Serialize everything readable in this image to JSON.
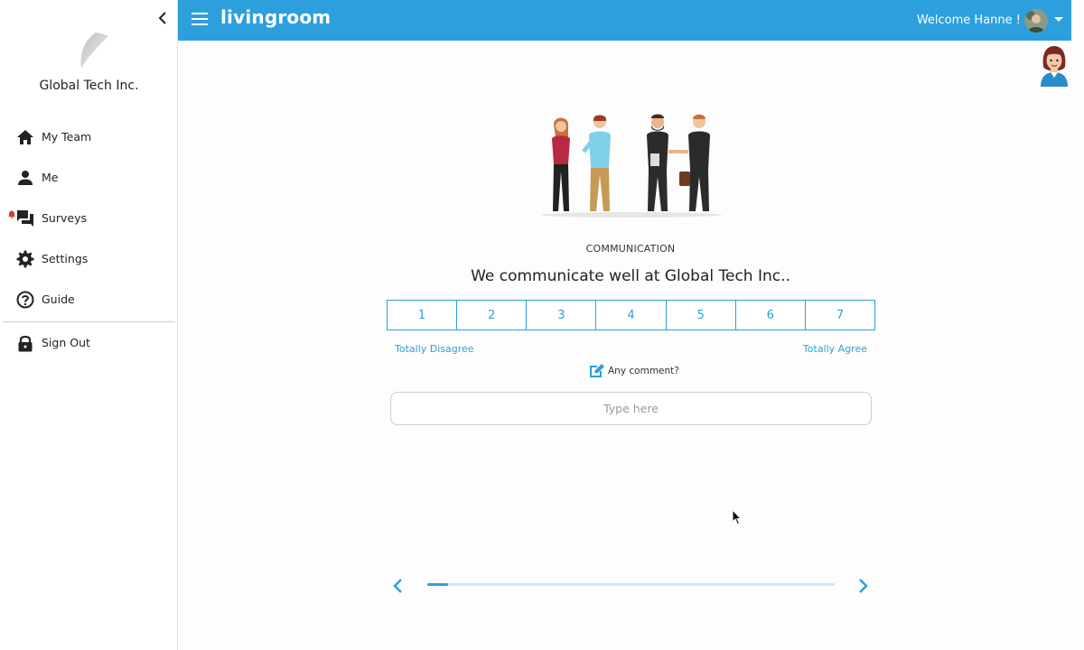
{
  "company": {
    "name": "Global Tech Inc."
  },
  "sidebar": {
    "items": [
      {
        "id": "my-team",
        "label": "My Team",
        "icon": "home-icon"
      },
      {
        "id": "me",
        "label": "Me",
        "icon": "person-icon"
      },
      {
        "id": "surveys",
        "label": "Surveys",
        "icon": "chat-icon",
        "notification": true
      },
      {
        "id": "settings",
        "label": "Settings",
        "icon": "gear-icon"
      },
      {
        "id": "guide",
        "label": "Guide",
        "icon": "help-icon"
      }
    ],
    "sign_out": {
      "label": "Sign Out",
      "icon": "lock-icon"
    }
  },
  "header": {
    "brand": "livingroom",
    "welcome": "Welcome Hanne !"
  },
  "survey": {
    "category": "COMMUNICATION",
    "question": "We communicate well at Global Tech Inc..",
    "scale": [
      "1",
      "2",
      "3",
      "4",
      "5",
      "6",
      "7"
    ],
    "scale_min_label": "Totally Disagree",
    "scale_max_label": "Totally Agree",
    "comment_prompt": "Any comment?",
    "comment_placeholder": "Type here",
    "progress": 0.05
  },
  "colors": {
    "accent": "#2d9fdc",
    "notification": "#e53935"
  }
}
